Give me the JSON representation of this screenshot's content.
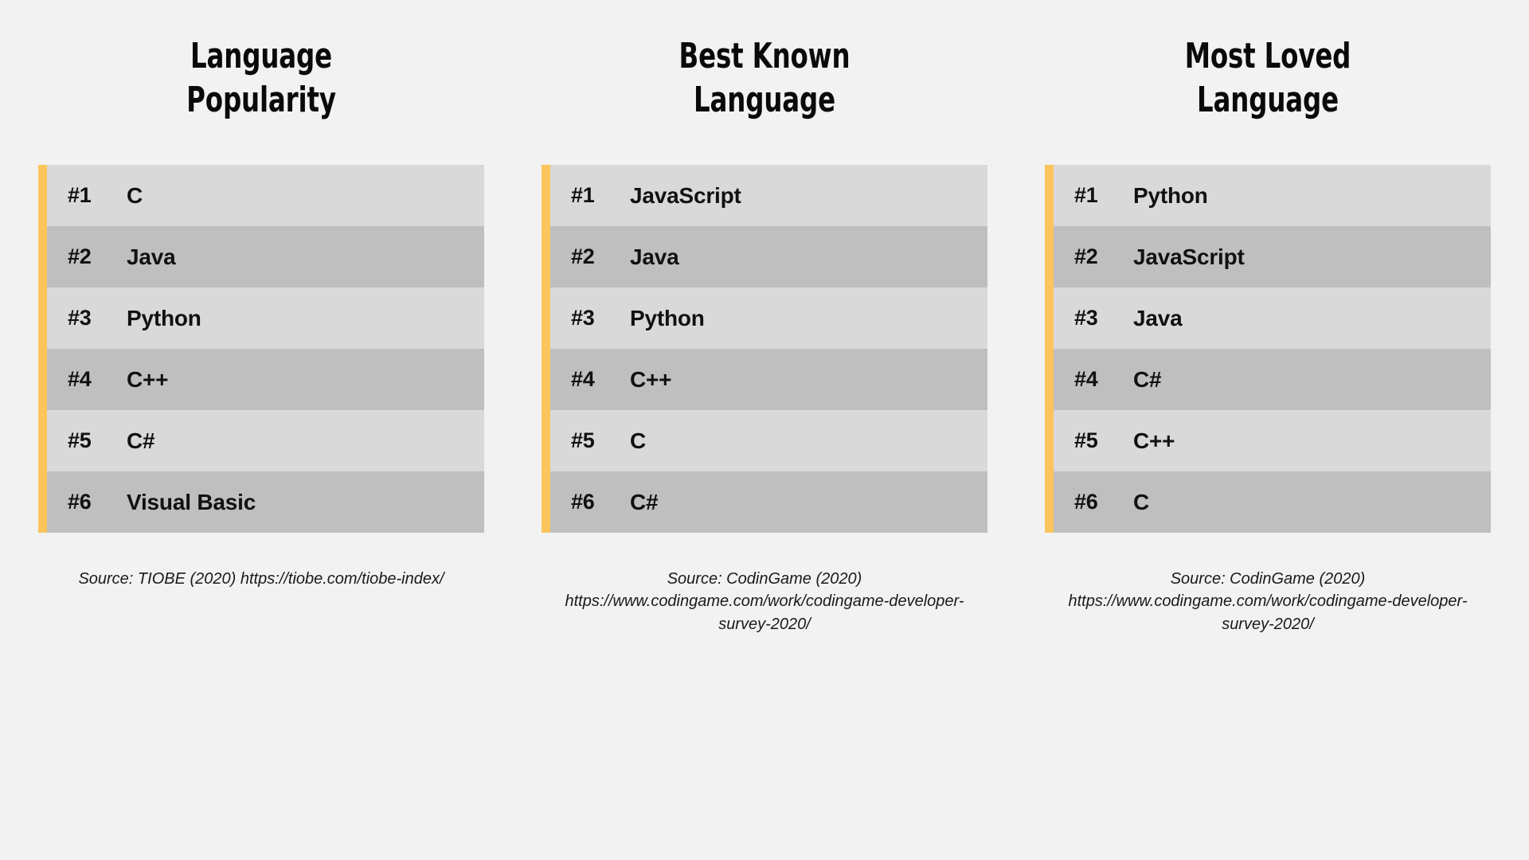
{
  "background_color": "#F2F2F2",
  "accent_color": "#FCC45C",
  "row_color_odd": "#D9D9D9",
  "row_color_even": "#BFBFBF",
  "panels": [
    {
      "title": "Language\nPopularity",
      "source": "Source: TIOBE (2020) https://tiobe.com/tiobe-index/",
      "rows": [
        {
          "rank": "#1",
          "language": "C"
        },
        {
          "rank": "#2",
          "language": "Java"
        },
        {
          "rank": "#3",
          "language": "Python"
        },
        {
          "rank": "#4",
          "language": "C++"
        },
        {
          "rank": "#5",
          "language": "C#"
        },
        {
          "rank": "#6",
          "language": "Visual Basic"
        }
      ]
    },
    {
      "title": "Best Known\nLanguage",
      "source": "Source: CodinGame (2020) https://www.codingame.com/work/codingame-developer-survey-2020/",
      "rows": [
        {
          "rank": "#1",
          "language": "JavaScript"
        },
        {
          "rank": "#2",
          "language": "Java"
        },
        {
          "rank": "#3",
          "language": "Python"
        },
        {
          "rank": "#4",
          "language": "C++"
        },
        {
          "rank": "#5",
          "language": "C"
        },
        {
          "rank": "#6",
          "language": "C#"
        }
      ]
    },
    {
      "title": "Most Loved\nLanguage",
      "source": "Source: CodinGame (2020) https://www.codingame.com/work/codingame-developer-survey-2020/",
      "rows": [
        {
          "rank": "#1",
          "language": "Python"
        },
        {
          "rank": "#2",
          "language": "JavaScript"
        },
        {
          "rank": "#3",
          "language": "Java"
        },
        {
          "rank": "#4",
          "language": "C#"
        },
        {
          "rank": "#5",
          "language": "C++"
        },
        {
          "rank": "#6",
          "language": "C"
        }
      ]
    }
  ]
}
